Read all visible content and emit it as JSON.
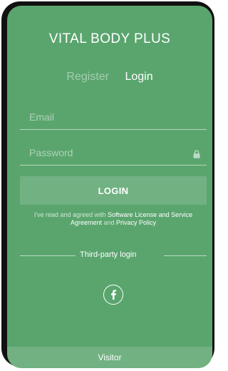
{
  "app": {
    "title": "VITAL BODY PLUS"
  },
  "tabs": [
    {
      "label": "Register",
      "active": false
    },
    {
      "label": "Login",
      "active": true
    }
  ],
  "form": {
    "email_placeholder": "Email",
    "email_value": "",
    "password_placeholder": "Password",
    "password_value": "",
    "password_icon": "lock-icon",
    "login_label": "LOGIN"
  },
  "agreement": {
    "prefix": "I've read and agreed with ",
    "license_link": "Software License and Service Agreement",
    "and": " and ",
    "privacy_link": "Privacy Policy"
  },
  "third_party": {
    "label": "Third-party login",
    "facebook_icon": "facebook-icon"
  },
  "visitor_label": "Visitor",
  "colors": {
    "background": "#5aa56e",
    "device_frame": "#111111",
    "text": "#ffffff"
  }
}
